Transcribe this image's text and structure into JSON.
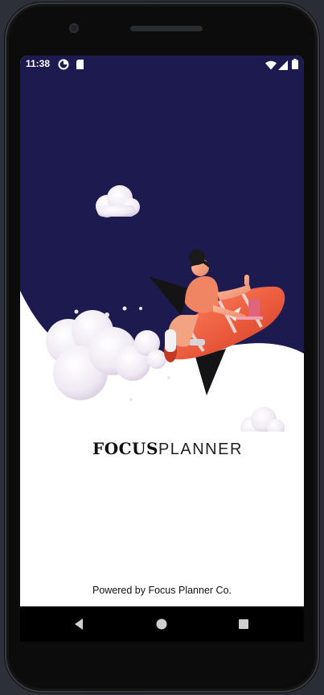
{
  "status_bar": {
    "time": "11:38",
    "left_icons": [
      "data-saver-icon",
      "sd-card-icon"
    ],
    "right_icons": [
      "wifi-icon",
      "signal-icon",
      "battery-icon"
    ]
  },
  "splash": {
    "brand_bold": "FOCUS",
    "brand_light": "PLANNER",
    "footer": "Powered by Focus Planner Co."
  },
  "navigation": {
    "buttons": [
      "back-icon",
      "home-icon",
      "recents-icon"
    ]
  },
  "colors": {
    "hero_background": "#1d1a4f",
    "screen_background": "#ffffff",
    "rocket_accent": "#e8573a",
    "nav_bar": "#000000"
  }
}
